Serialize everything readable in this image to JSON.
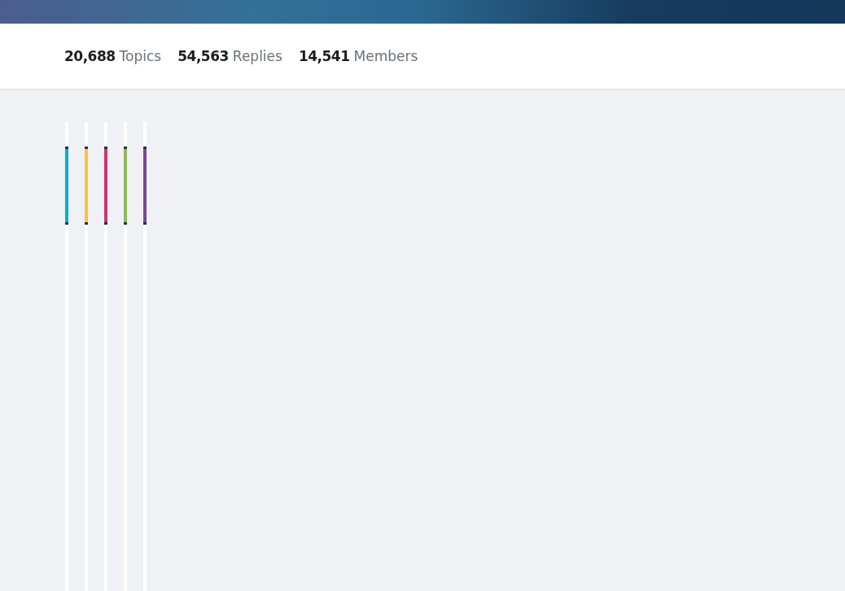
{
  "stats": [
    {
      "count": "20,688",
      "label": "Topics"
    },
    {
      "count": "54,563",
      "label": "Replies"
    },
    {
      "count": "14,541",
      "label": "Members"
    }
  ],
  "forum_cards": [
    {
      "color": "#1aa6d0"
    },
    {
      "color": "#f2c352"
    },
    {
      "color": "#d9306f"
    },
    {
      "color": "#8bbd45"
    },
    {
      "color": "#7b4696"
    }
  ]
}
